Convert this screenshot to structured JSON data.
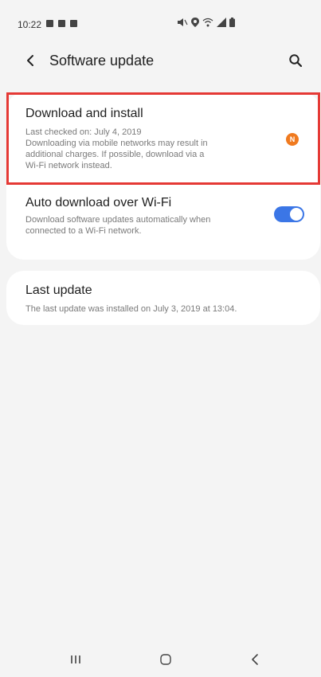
{
  "status_bar": {
    "time": "10:22"
  },
  "header": {
    "title": "Software update",
    "back_icon": "chevron-left-icon",
    "search_icon": "search-icon"
  },
  "download_install": {
    "title": "Download and install",
    "subtitle_lines": [
      "Last checked on: July 4, 2019",
      "Downloading via mobile networks may result in",
      "additional charges. If possible, download via a",
      "Wi-Fi network instead."
    ],
    "badge_text": "N",
    "badge_color": "#f07a1f",
    "highlight_color": "#e53935"
  },
  "auto_download": {
    "title": "Auto download over Wi-Fi",
    "subtitle_lines": [
      "Download software updates automatically when",
      "connected to a Wi-Fi network."
    ],
    "toggle_on": true,
    "toggle_color": "#3b76e6"
  },
  "last_update": {
    "title": "Last update",
    "subtitle": "The last update was installed on July 3, 2019 at 13:04."
  },
  "nav_bar": {
    "recent_icon": "recent-apps-icon",
    "home_icon": "home-icon",
    "back_icon": "back-icon"
  }
}
